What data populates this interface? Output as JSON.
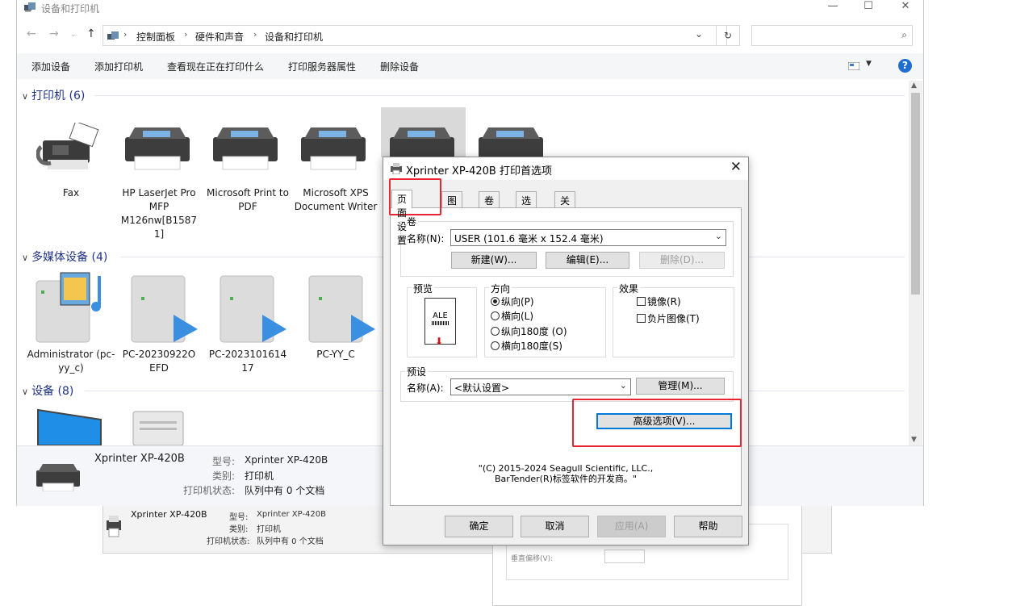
{
  "explorer": {
    "title": "设备和打印机",
    "window_controls": {
      "minimize": "—",
      "maximize": "☐",
      "close": "✕"
    },
    "breadcrumb": [
      "控制面板",
      "硬件和声音",
      "设备和打印机"
    ],
    "toolbar": [
      "添加设备",
      "添加打印机",
      "查看现在正在打印什么",
      "打印服务器属性",
      "删除设备"
    ],
    "sections": {
      "printers": "打印机 (6)",
      "media": "多媒体设备 (4)",
      "devices": "设备 (8)"
    },
    "printers": [
      {
        "name": "Fax"
      },
      {
        "name": "HP LaserJet Pro MFP M126nw[B1587 1]"
      },
      {
        "name": "Microsoft Print to PDF"
      },
      {
        "name": "Microsoft XPS Document Writer"
      }
    ],
    "media": [
      {
        "name": "Administrator (pc-yy_c)"
      },
      {
        "name": "PC-20230922O EFD"
      },
      {
        "name": "PC-2023101614 17"
      },
      {
        "name": "PC-YY_C"
      }
    ],
    "details": {
      "name": "Xprinter XP-420B",
      "model_key": "型号:",
      "model_val": "Xprinter XP-420B",
      "cat_key": "类别:",
      "cat_val": "打印机",
      "status_key": "打印机状态:",
      "status_val": "队列中有 0 个文档"
    }
  },
  "background_window": {
    "name": "Xprinter XP-420B",
    "model_key": "型号:",
    "model_val": "Xprinter XP-420B",
    "cat_key": "类别:",
    "cat_val": "打印机",
    "status_key": "打印机状态:",
    "status_val": "队列中有 0 个文档",
    "offset_label": "垂直偏移(V):"
  },
  "dialog": {
    "title": "Xprinter XP-420B 打印首选项",
    "tabs": [
      "页面设置",
      "图形",
      "卷",
      "选项",
      "关于"
    ],
    "roll_group": "卷",
    "name_label": "名称(N):",
    "roll_value": "USER (101.6 毫米 x 152.4 毫米)",
    "btn_new": "新建(W)...",
    "btn_edit": "编辑(E)...",
    "btn_delete": "删除(D)...",
    "preview_group": "预览",
    "preview_text": "ALE",
    "orientation_group": "方向",
    "orientations": [
      {
        "label": "纵向(P)",
        "selected": true
      },
      {
        "label": "横向(L)",
        "selected": false
      },
      {
        "label": "纵向180度 (O)",
        "selected": false
      },
      {
        "label": "横向180度(S)",
        "selected": false
      }
    ],
    "effects_group": "效果",
    "effects": [
      "镜像(R)",
      "负片图像(T)"
    ],
    "preset_group": "预设",
    "preset_label": "名称(A):",
    "preset_value": "<默认设置>",
    "btn_manage": "管理(M)...",
    "btn_advanced": "高级选项(V)...",
    "copyright_line1": "\"(C) 2015-2024 Seagull Scientific, LLC.,",
    "copyright_line2": "BarTender(R)标签软件的开发商。\"",
    "footer": {
      "ok": "确定",
      "cancel": "取消",
      "apply": "应用(A)",
      "help": "帮助"
    }
  },
  "colors": {
    "highlight": "#e8262f",
    "section_blue": "#1e3287",
    "focus": "#0078d7"
  }
}
